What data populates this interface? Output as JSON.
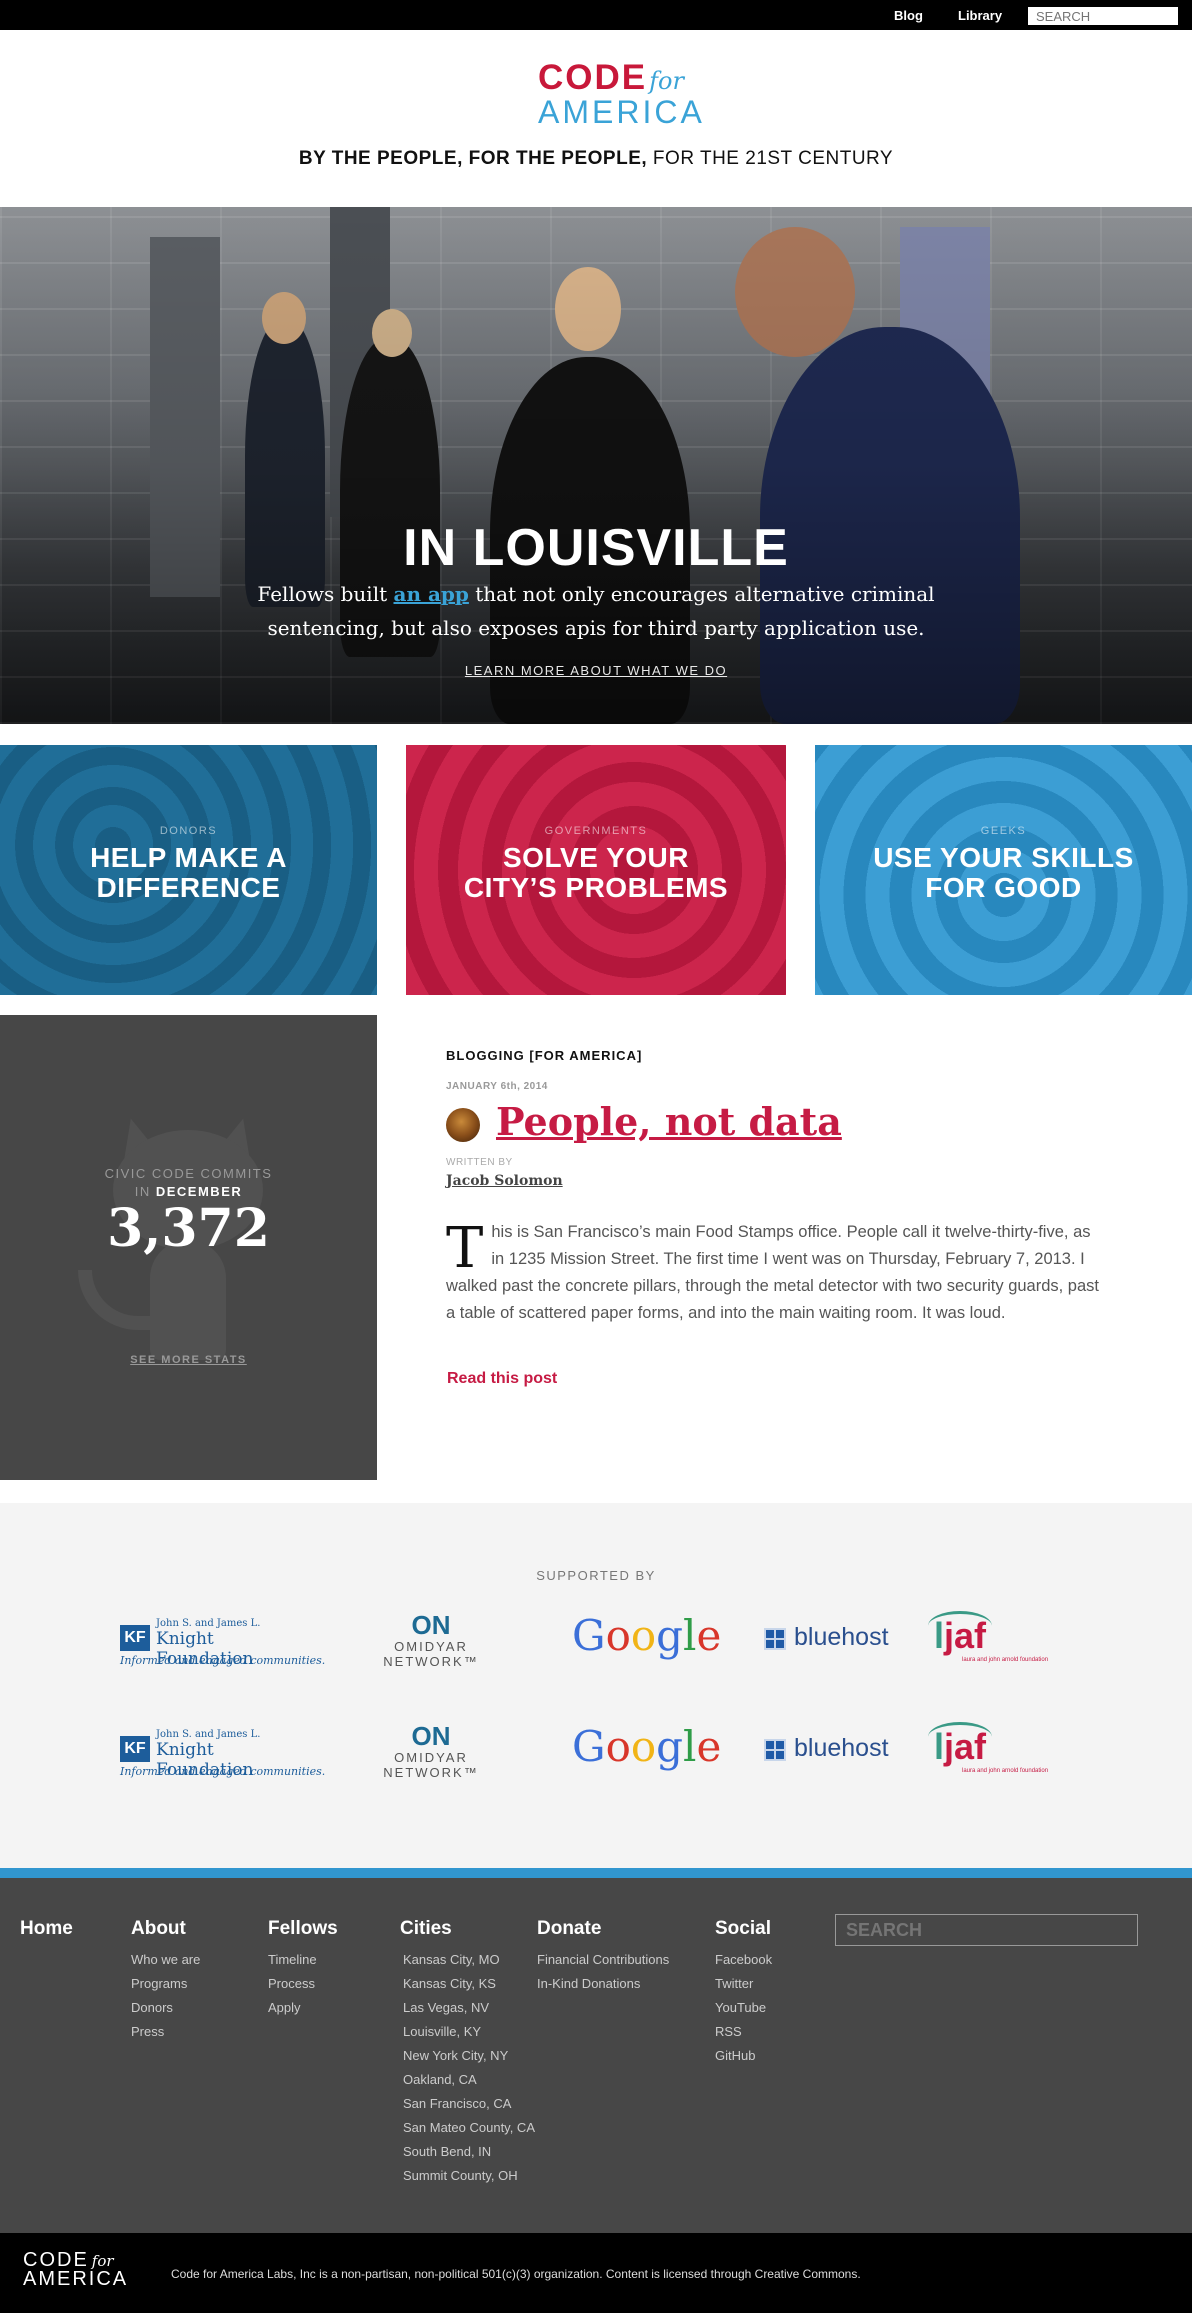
{
  "topnav": {
    "blog": "Blog",
    "library": "Library",
    "search_placeholder": "SEARCH"
  },
  "logo": {
    "code": "CODE",
    "for": "for",
    "america": "AMERICA"
  },
  "tagline": {
    "bold": "BY THE PEOPLE, FOR THE PEOPLE,",
    "rest": " FOR THE 21ST CENTURY"
  },
  "hero": {
    "title": "IN LOUISVILLE",
    "desc_before": "Fellows built ",
    "desc_link": "an app",
    "desc_after": " that not only encourages alternative criminal sentencing, but also exposes apis for third party application use.",
    "learn_more": "LEARN MORE ABOUT WHAT WE DO"
  },
  "cards": [
    {
      "label": "DONORS",
      "line1": "HELP MAKE A",
      "line2": "DIFFERENCE"
    },
    {
      "label": "GOVERNMENTS",
      "line1": "SOLVE YOUR",
      "line2": "CITY’S PROBLEMS"
    },
    {
      "label": "GEEKS",
      "line1": "USE YOUR SKILLS",
      "line2": "FOR GOOD"
    }
  ],
  "stats": {
    "label_line1": "CIVIC CODE COMMITS",
    "label_in": "IN ",
    "month": "DECEMBER",
    "value": "3,372",
    "more": "SEE MORE STATS"
  },
  "blog": {
    "heading": "BLOGGING [FOR AMERICA]",
    "date": "JANUARY 6th, 2014",
    "title": "People, not data",
    "written_by": "WRITTEN BY",
    "author": "Jacob Solomon",
    "drop_cap": "T",
    "excerpt": "his is San Francisco’s main Food Stamps office. People call it twelve-thirty-five, as in 1235 Mission Street. The first time I went was on Thursday, February 7, 2013. I walked past the concrete pillars, through the metal detector with two security guards, past a table of scattered paper forms, and into the main waiting room. It was loud.",
    "read_more": "Read this post"
  },
  "supporters": {
    "heading": "SUPPORTED BY",
    "knight": {
      "mark": "KF",
      "line1": "John S. and James L.",
      "line2": "Knight Foundation",
      "line3": "Informed and engaged communities."
    },
    "omidyar": {
      "mark": "ON",
      "name": "OMIDYAR NETWORK™"
    },
    "google": "Google",
    "bluehost": "bluehost",
    "ljaf": {
      "l": "l",
      "jaf": "jaf",
      "sub": "laura and john arnold foundation"
    }
  },
  "footer": {
    "home": "Home",
    "about": {
      "title": "About",
      "links": [
        "Who we are",
        "Programs",
        "Donors",
        "Press"
      ]
    },
    "fellows": {
      "title": "Fellows",
      "links": [
        "Timeline",
        "Process",
        "Apply"
      ]
    },
    "cities": {
      "title": "Cities",
      "links": [
        "Kansas City, MO",
        "Kansas City, KS",
        "Las Vegas, NV",
        "Louisville, KY",
        "New York City, NY",
        "Oakland, CA",
        "San Francisco, CA",
        "San Mateo County, CA",
        "South Bend, IN",
        "Summit County, OH"
      ]
    },
    "donate": {
      "title": "Donate",
      "links": [
        "Financial Contributions",
        "In-Kind Donations"
      ]
    },
    "social": {
      "title": "Social",
      "links": [
        "Facebook",
        "Twitter",
        "YouTube",
        "RSS",
        "GitHub"
      ]
    },
    "search_placeholder": "SEARCH",
    "bottom_logo": {
      "code": "CODE",
      "for": "for",
      "america": "AMERICA"
    },
    "legal": "Code for America Labs, Inc is a non-partisan, non-political 501(c)(3) organization. Content is licensed through Creative Commons."
  },
  "colors": {
    "red": "#c61b44",
    "blue": "#3196cf",
    "dark_blue": "#1d6a93",
    "dark_gray": "#474747"
  }
}
